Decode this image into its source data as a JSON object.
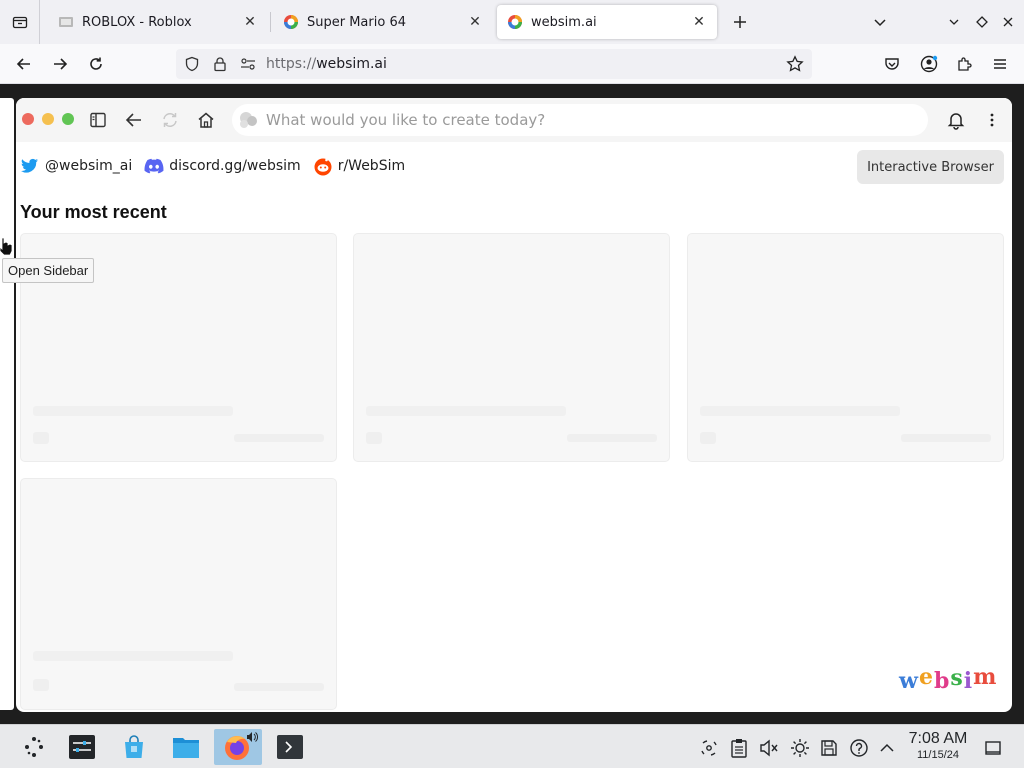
{
  "browser": {
    "tabs": [
      {
        "title": "ROBLOX - Roblox",
        "active": false,
        "icon": "roblox-favicon"
      },
      {
        "title": "Super Mario 64",
        "active": false,
        "icon": "websim-favicon"
      },
      {
        "title": "websim.ai",
        "active": true,
        "icon": "websim-favicon"
      }
    ],
    "url": {
      "scheme": "https://",
      "host": "websim.ai"
    }
  },
  "websim": {
    "prompt_placeholder": "What would you like to create today?",
    "links": [
      {
        "label": "@websim_ai",
        "icon": "twitter-icon"
      },
      {
        "label": "discord.gg/websim",
        "icon": "discord-icon"
      },
      {
        "label": "r/WebSim",
        "icon": "reddit-icon"
      }
    ],
    "interactive_browser_label": "Interactive Browser",
    "recent_title": "Your most recent",
    "recent_cards": 4,
    "logo_letters": [
      "w",
      "e",
      "b",
      "s",
      "i",
      "m"
    ],
    "logo_colors": [
      "#3b7dd8",
      "#f0a020",
      "#e03c8a",
      "#3bb04a",
      "#9b59d0",
      "#e84c3d"
    ],
    "tooltip": "Open Sidebar"
  },
  "taskbar": {
    "time": "7:08 AM",
    "date": "11/15/24"
  },
  "colors": {
    "traffic_red": "#ed6a5e",
    "traffic_yellow": "#f5c04f",
    "traffic_green": "#61c554",
    "twitter": "#1d9bf0",
    "discord": "#5865f2",
    "reddit": "#ff4500"
  }
}
